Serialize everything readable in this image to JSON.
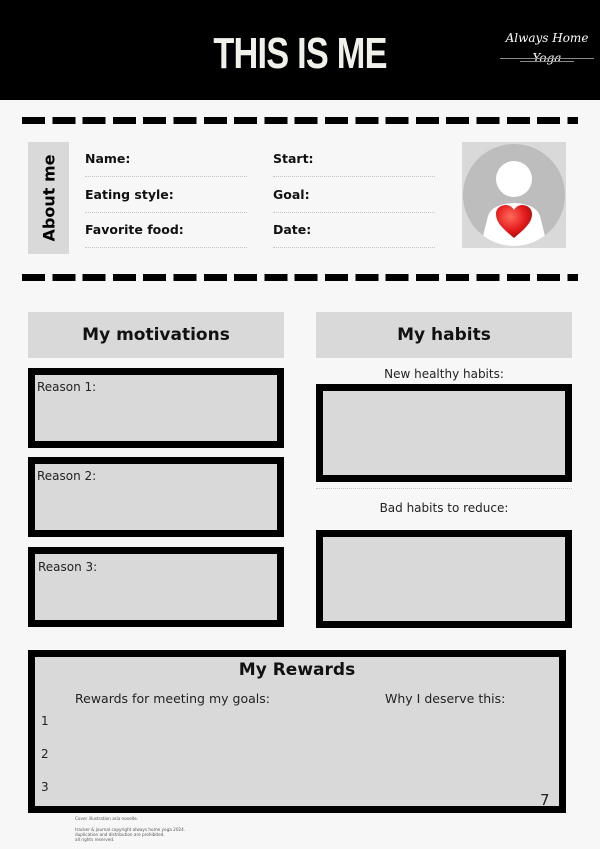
{
  "header": {
    "title": "THIS IS ME",
    "logo_script": "Always Home Yoga"
  },
  "about": {
    "label": "About me",
    "fields_left": [
      "Name:",
      "Eating style:",
      "Favorite food:"
    ],
    "fields_right": [
      "Start:",
      "Goal:",
      "Date:"
    ],
    "avatar_icon": "person-with-heart-icon",
    "colors": {
      "heart": "#e31b1b",
      "avatar_circle": "#bdbdbd"
    }
  },
  "motivations": {
    "title": "My motivations",
    "reasons": [
      "Reason 1:",
      "Reason 2:",
      "Reason 3:"
    ]
  },
  "habits": {
    "title": "My habits",
    "new_label": "New healthy habits:",
    "bad_label": "Bad habits to reduce:"
  },
  "rewards": {
    "title": "My Rewards",
    "col_left": "Rewards for meeting my goals:",
    "col_right": "Why I deserve this:",
    "numbers": [
      "1",
      "2",
      "3"
    ]
  },
  "page_number": "7",
  "footer": {
    "credit": "Cover illustration aria novelle.",
    "copyright": [
      "tracker & journal copyright always home yoga 2024.",
      "duplication and distribution are prohibited.",
      "all rights reserved."
    ]
  }
}
